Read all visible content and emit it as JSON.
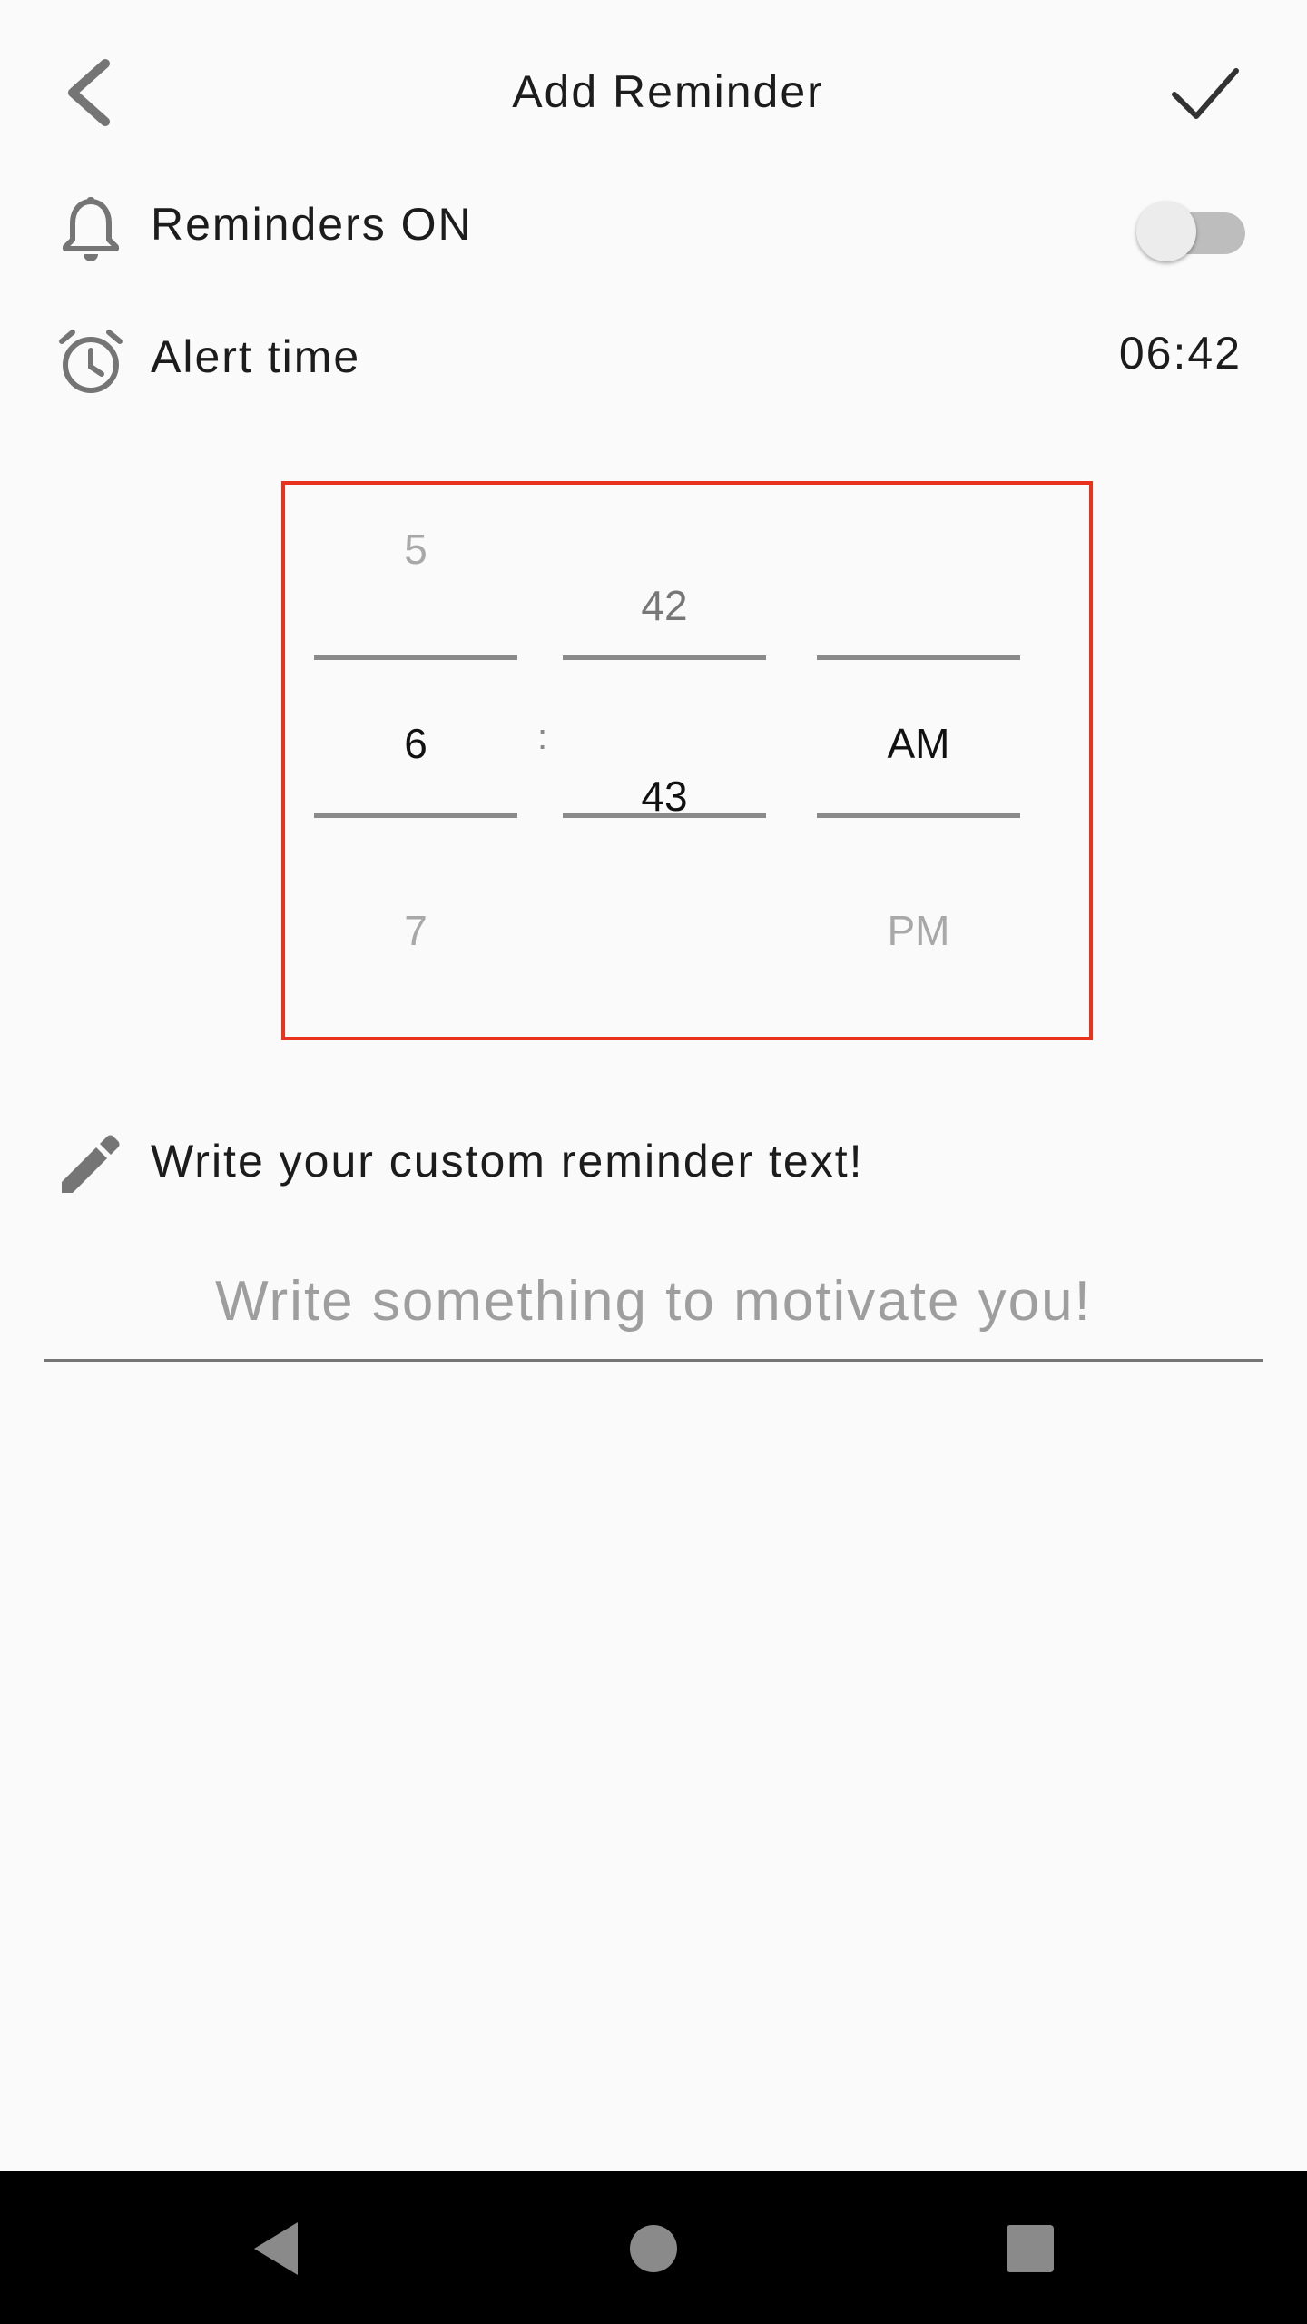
{
  "header": {
    "title": "Add Reminder",
    "back_icon": "chevron-left-icon",
    "confirm_icon": "check-icon"
  },
  "reminders": {
    "label": "Reminders ON",
    "icon": "bell-icon",
    "enabled": false
  },
  "alert": {
    "label": "Alert time",
    "icon": "alarm-clock-icon",
    "value": "06:42"
  },
  "picker": {
    "hours": {
      "above": "5",
      "selected": "6",
      "below": "7"
    },
    "separator": ":",
    "minutes": {
      "above": "42",
      "selected": "43"
    },
    "period": {
      "selected": "AM",
      "below": "PM"
    }
  },
  "custom_text": {
    "label": "Write your custom reminder text!",
    "icon": "pencil-icon",
    "placeholder": "Write something to motivate you!"
  },
  "navbar": {
    "back_icon": "triangle-back-icon",
    "home_icon": "circle-home-icon",
    "recents_icon": "square-recents-icon"
  },
  "colors": {
    "accent_border": "#e8321e",
    "icon_gray": "#757575",
    "background": "#fafafa"
  }
}
